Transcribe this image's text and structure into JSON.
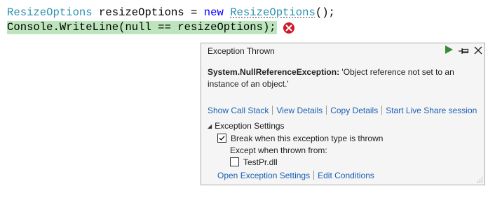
{
  "code": {
    "line1": {
      "type1": "ResizeOptions",
      "var_decl": " resizeOptions = ",
      "new_kw": "new",
      "space": " ",
      "type2": "ResizeOptions",
      "tail": "();"
    },
    "line2": "Console.WriteLine(null == resizeOptions);",
    "highlight_color": "#bde5bd"
  },
  "error_glyph": {
    "icon": "error-circle-icon",
    "color": "#d1182b"
  },
  "popup": {
    "title": "Exception Thrown",
    "toolbar": {
      "continue_icon": "play-icon",
      "pin_icon": "pin-icon",
      "close_icon": "close-icon"
    },
    "exception_type": "System.NullReferenceException:",
    "exception_message": " 'Object reference not set to an instance of an object.'",
    "links": {
      "call_stack": "Show Call Stack",
      "view_details": "View Details",
      "copy_details": "Copy Details",
      "live_share": "Start Live Share session"
    },
    "settings": {
      "header": "Exception Settings",
      "break_label": "Break when this exception type is thrown",
      "break_checked": true,
      "except_label": "Except when thrown from:",
      "module_label": "TestPr.dll",
      "module_checked": false,
      "open_settings": "Open Exception Settings",
      "edit_conditions": "Edit Conditions"
    }
  },
  "colors": {
    "link": "#1a5fb4",
    "type": "#2b91af",
    "keyword": "#0000ff",
    "play": "#388a34"
  }
}
